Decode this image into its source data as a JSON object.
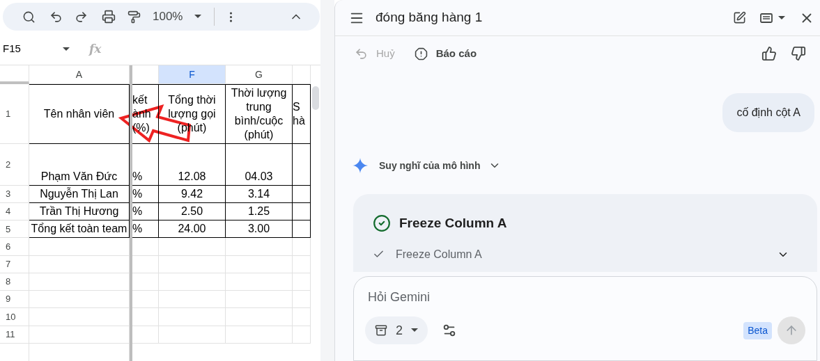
{
  "toolbar": {
    "zoom": "100%"
  },
  "formula_bar": {
    "cell_ref": "F15",
    "fx": "fx"
  },
  "columns": [
    {
      "label": "A",
      "selected": false
    },
    {
      "selected": false
    },
    {
      "label": "F",
      "selected": true
    },
    {
      "label": "G",
      "selected": false
    },
    {
      "selected": false
    }
  ],
  "rows": [
    {
      "number": "1",
      "cells": [
        "Tên nhân viên",
        "kết\nành\n(%)",
        "Tổng thời\nlượng gọi\n(phút)",
        "Thời lượng\ntrung\nbình/cuộc\n(phút)",
        "S\nhà"
      ]
    },
    {
      "number": "2",
      "cells": [
        "Phạm Văn Đức",
        "%",
        "12.08",
        "04.03"
      ]
    },
    {
      "number": "3",
      "cells": [
        "Nguyễn Thị Lan",
        "%",
        "9.42",
        "3.14"
      ]
    },
    {
      "number": "4",
      "cells": [
        "Trần Thị Hương",
        "%",
        "2.50",
        "1.25"
      ]
    },
    {
      "number": "5",
      "cells": [
        "Tổng kết toàn team",
        "%",
        "24.00",
        "3.00"
      ]
    },
    {
      "number": "6"
    },
    {
      "number": "7"
    },
    {
      "number": "8"
    },
    {
      "number": "9"
    },
    {
      "number": "10"
    },
    {
      "number": "11"
    }
  ],
  "chat": {
    "title": "đóng băng hàng 1",
    "actions": [
      {
        "label": "Huỷ",
        "disabled": true
      },
      {
        "label": "Báo cáo",
        "disabled": false
      }
    ],
    "user_message": "cố định cột A",
    "thinking_label": "Suy nghĩ của mô hình",
    "card": {
      "title": "Freeze Column A",
      "steps": [
        {
          "label": "Freeze Column A",
          "done": true
        }
      ]
    },
    "input": {
      "placeholder": "Hỏi Gemini"
    },
    "source_count": "2",
    "badge": "Beta",
    "send_disabled": true
  }
}
